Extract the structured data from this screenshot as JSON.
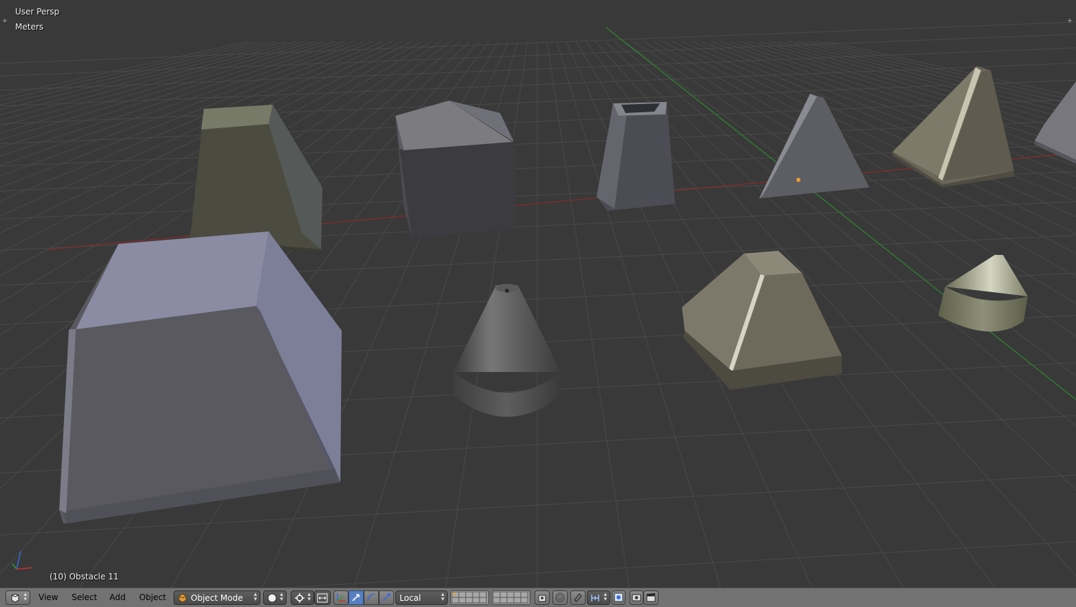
{
  "viewport": {
    "view_name": "User Persp",
    "units": "Meters",
    "active_object": "(10) Obstacle 11"
  },
  "header": {
    "menus": [
      {
        "label": "View"
      },
      {
        "label": "Select"
      },
      {
        "label": "Add"
      },
      {
        "label": "Object"
      }
    ],
    "mode": "Object Mode",
    "pivot": "Local"
  },
  "colors": {
    "background": "#393939",
    "grid_line": "#4a4a4a",
    "x_axis": "#8a2a2a",
    "y_axis": "#2f8a2f",
    "header": "#727272",
    "active_button": "#5680c2"
  },
  "icons": {
    "editor_type": "3d-view-icon",
    "mode": "cube-icon",
    "shading": "solid-sphere-icon",
    "pivot": "pivot-point-icon",
    "manipulator": "manipulator-icon",
    "translate": "translate-arrow-icon",
    "rotate": "rotate-arc-icon",
    "scale": "scale-icon",
    "layers": "layers-grid-icon",
    "lock": "lock-camera-icon",
    "proportional": "proportional-edit-icon",
    "snap": "magnet-icon",
    "snap_element": "snap-increment-icon",
    "render_preview": "render-preview-icon",
    "camera": "camera-icon",
    "clapper": "clapper-icon"
  }
}
